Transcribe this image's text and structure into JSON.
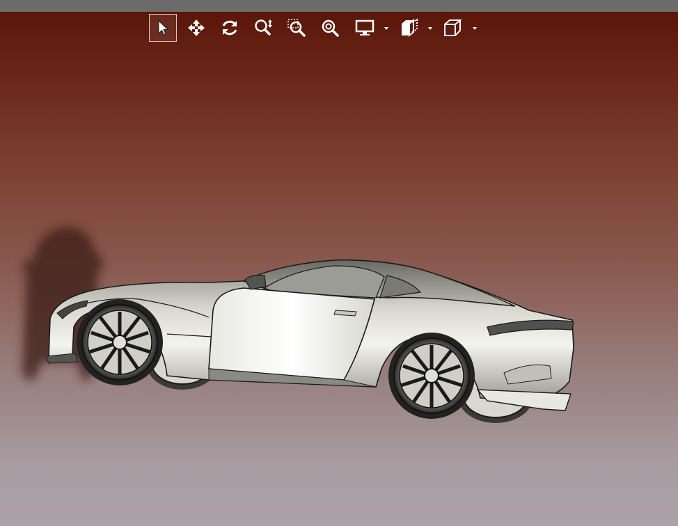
{
  "window": {
    "title": ""
  },
  "toolbar": {
    "tools": [
      {
        "name": "select",
        "icon": "pointer-icon",
        "active": true
      },
      {
        "name": "pan",
        "icon": "move-arrows-icon",
        "active": false
      },
      {
        "name": "rotate",
        "icon": "rotate-icon",
        "active": false
      },
      {
        "name": "zoom",
        "icon": "zoom-updown-icon",
        "active": false
      },
      {
        "name": "zoom-window",
        "icon": "zoom-window-icon",
        "active": false
      },
      {
        "name": "zoom-fit",
        "icon": "zoom-fit-icon",
        "active": false
      },
      {
        "name": "display-mode",
        "icon": "monitor-icon",
        "active": false,
        "has_dropdown": true
      },
      {
        "name": "section",
        "icon": "section-box-icon",
        "active": false,
        "has_dropdown": true
      },
      {
        "name": "view-orientation",
        "icon": "cube-icon",
        "active": false,
        "has_dropdown": true
      }
    ]
  },
  "colors": {
    "background_top": "#5a1608",
    "background_bottom": "#aaa2a8",
    "toolbar_icon": "#ffffff",
    "active_border": "#d8c8c0",
    "model_body": "#cfcfc8",
    "model_edges": "#1a1a1a"
  }
}
